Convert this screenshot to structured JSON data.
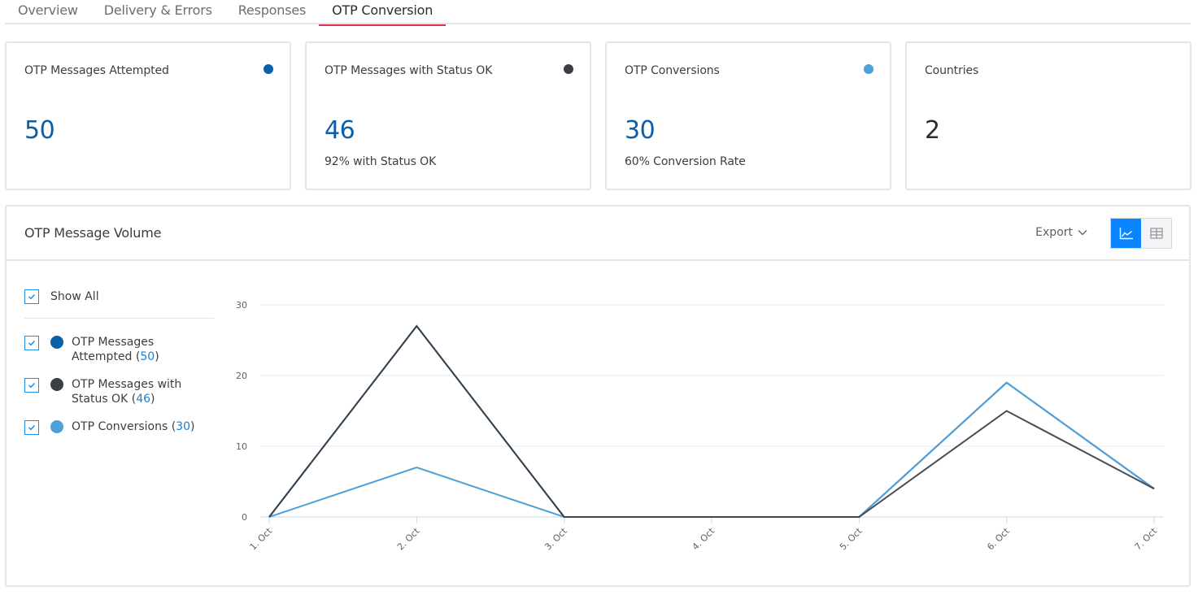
{
  "tabs": [
    {
      "label": "Overview",
      "active": false
    },
    {
      "label": "Delivery & Errors",
      "active": false
    },
    {
      "label": "Responses",
      "active": false
    },
    {
      "label": "OTP Conversion",
      "active": true
    }
  ],
  "cards": [
    {
      "title": "OTP Messages Attempted",
      "value": "50",
      "sub": "",
      "dot_color": "#0b5ea8"
    },
    {
      "title": "OTP Messages with Status OK",
      "value": "46",
      "sub": "92% with Status OK",
      "dot_color": "#3b3f44"
    },
    {
      "title": "OTP Conversions",
      "value": "30",
      "sub": "60% Conversion Rate",
      "dot_color": "#4fa0d8"
    },
    {
      "title": "Countries",
      "value": "2",
      "sub": "",
      "dot_color": ""
    }
  ],
  "panel": {
    "title": "OTP Message Volume",
    "export_label": "Export",
    "view_toggle": {
      "options": [
        "line-chart",
        "table"
      ],
      "selected": "line-chart"
    },
    "legend": {
      "show_all_label": "Show All",
      "show_all_checked": true,
      "items": [
        {
          "label": "OTP Messages Attempted",
          "count": "50",
          "color": "#0b5ea8",
          "checked": true
        },
        {
          "label": "OTP Messages with Status OK",
          "count": "46",
          "color": "#3b3f44",
          "checked": true
        },
        {
          "label": "OTP Conversions",
          "count": "30",
          "color": "#4fa0d8",
          "checked": true
        }
      ]
    }
  },
  "chart_data": {
    "type": "line",
    "title": "OTP Message Volume",
    "xlabel": "",
    "ylabel": "",
    "categories": [
      "1. Oct",
      "2. Oct",
      "3. Oct",
      "4. Oct",
      "5. Oct",
      "6. Oct",
      "7. Oct"
    ],
    "yticks": [
      0,
      10,
      20,
      30
    ],
    "ylim": [
      0,
      30
    ],
    "grid": true,
    "legend_position": "left",
    "series": [
      {
        "name": "OTP Messages Attempted",
        "color": "#0b5ea8",
        "values": [
          0,
          27,
          0,
          0,
          0,
          19,
          4
        ]
      },
      {
        "name": "OTP Messages with Status OK",
        "color": "#3b3f44",
        "values": [
          0,
          27,
          0,
          0,
          0,
          15,
          4
        ]
      },
      {
        "name": "OTP Conversions",
        "color": "#4fa0d8",
        "values": [
          0,
          7,
          0,
          0,
          0,
          19,
          4
        ]
      }
    ]
  }
}
